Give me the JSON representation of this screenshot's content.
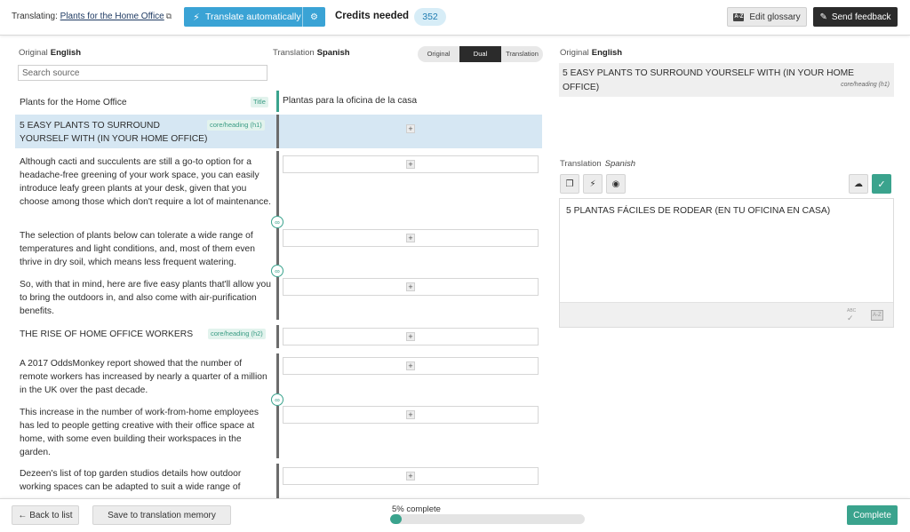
{
  "header": {
    "translating_label": "Translating:",
    "document_title": "Plants for the Home Office",
    "translate_auto_label": "Translate automatically",
    "credits_label": "Credits needed",
    "credits_value": "352",
    "edit_glossary_label": "Edit glossary",
    "send_feedback_label": "Send feedback",
    "glossary_icon_text": "A-Z"
  },
  "left_panel": {
    "original_label": "Original",
    "original_lang": "English",
    "translation_label": "Translation",
    "translation_lang": "Spanish",
    "search_placeholder": "Search source",
    "view_modes": [
      "Original",
      "Dual",
      "Translation"
    ],
    "active_view_mode": "Dual",
    "segments": [
      {
        "source": "Plants for the Home Office",
        "tag": "Title",
        "target": "Plantas para la oficina de la casa"
      },
      {
        "source": "5 EASY PLANTS TO SURROUND YOURSELF WITH (IN YOUR HOME OFFICE)",
        "tag": "core/heading (h1)",
        "target": ""
      },
      {
        "source": "Although cacti and succulents are still a go-to option for a headache-free greening of your work space, you can easily introduce leafy green plants at your desk, given that you choose among those which don't require a lot of maintenance.",
        "tag": "",
        "target": ""
      },
      {
        "source": "The selection of plants below can tolerate a wide range of temperatures and light conditions, and, most of them even thrive in dry soil, which means less frequent watering.",
        "tag": "",
        "target": ""
      },
      {
        "source": "So, with that in mind, here are five easy plants that'll allow you to bring the outdoors in, and also come with air-purification benefits.",
        "tag": "",
        "target": ""
      },
      {
        "source": "THE RISE OF HOME OFFICE WORKERS",
        "tag": "core/heading (h2)",
        "target": ""
      },
      {
        "source": "A 2017 OddsMonkey report showed that the number of remote workers has increased by nearly a quarter of a million in the UK over the past decade.",
        "tag": "",
        "target": ""
      },
      {
        "source": "This increase in the number of work-from-home employees has led to people getting creative with their office space at home, with some even building their workspaces in the garden.",
        "tag": "",
        "target": ""
      },
      {
        "source": "Dezeen's list of top garden studios details how outdoor working spaces can be adapted to suit a wide range of",
        "tag": "",
        "target": ""
      }
    ]
  },
  "right_panel": {
    "original_label": "Original",
    "original_lang": "English",
    "original_text": "5 EASY PLANTS TO SURROUND YOURSELF WITH (IN YOUR HOME OFFICE)",
    "original_tag": "core/heading (h1)",
    "translation_label": "Translation",
    "translation_lang": "Spanish",
    "translation_text": "5 PLANTAS FÁCILES DE RODEAR (EN TU OFICINA EN CASA)",
    "abc_icon_text": "ABC",
    "az_icon_text": "A-Z"
  },
  "footer": {
    "back_label": "← Back to list",
    "save_memory_label": "Save to translation memory",
    "progress_label": "5% complete",
    "progress_percent": 5,
    "complete_label": "Complete"
  },
  "colors": {
    "accent_blue": "#3aa3d5",
    "accent_teal": "#3aa38d",
    "highlight_row": "#d6e7f3",
    "dark_button": "#2b2b2b"
  },
  "icons": {
    "translate_auto": "bolt-icon",
    "translate_settings": "gear-icon",
    "glossary": "az-glossary-icon",
    "feedback": "pencil-icon",
    "external": "external-link-icon",
    "segment_link": "link-icon",
    "segment_add": "plus-icon",
    "copy_source": "copy-icon",
    "machine_translate": "bolt-icon",
    "toggle_visibility": "eye-slash-icon",
    "cloud_upload": "cloud-upload-icon",
    "confirm": "check-icon",
    "spellcheck": "spellcheck-icon",
    "glossary_lookup": "az-glossary-icon"
  }
}
